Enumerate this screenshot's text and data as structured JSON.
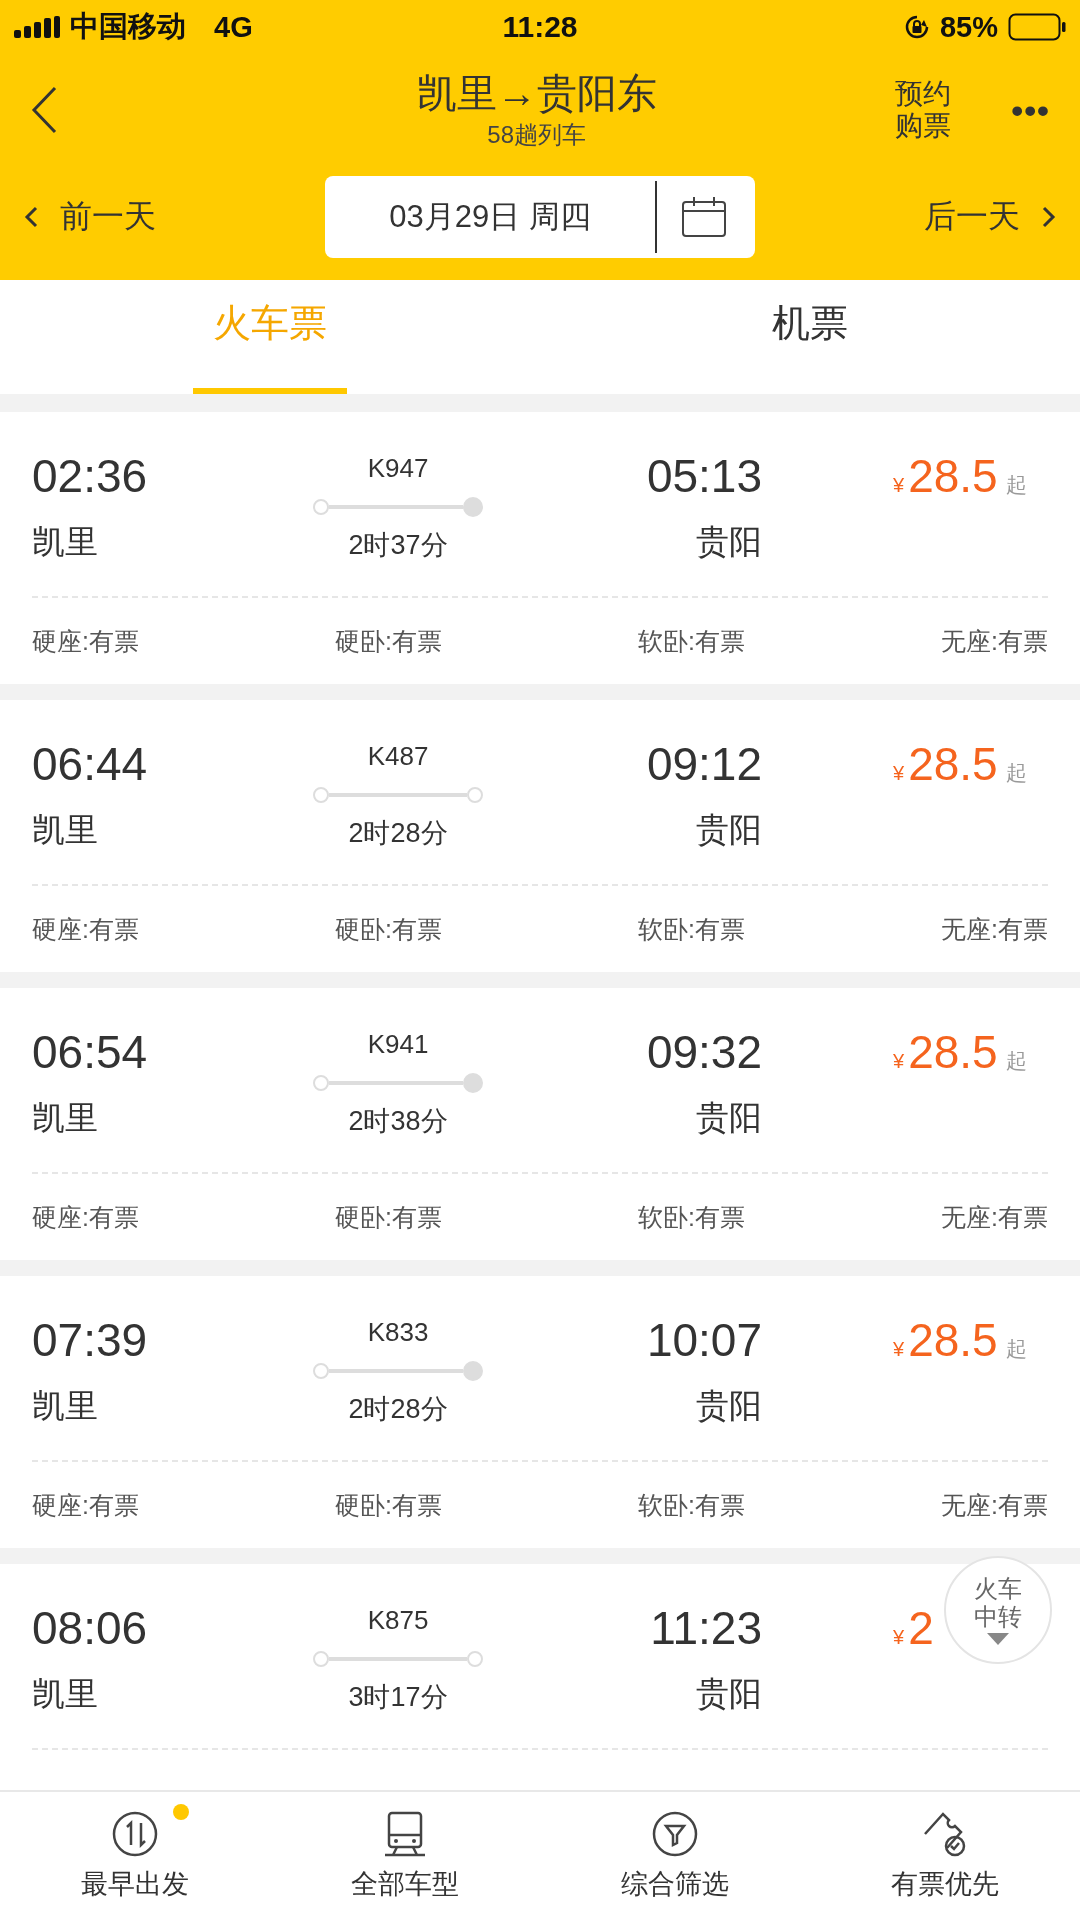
{
  "status_bar": {
    "carrier": "中国移动",
    "network": "4G",
    "time": "11:28",
    "battery": "85%"
  },
  "header": {
    "title": "凯里→贵阳东",
    "subtitle": "58趟列车",
    "action": "预约购票",
    "more": "•••"
  },
  "date_bar": {
    "prev": "前一天",
    "date": "03月29日 周四",
    "next": "后一天"
  },
  "tabs": [
    {
      "label": "火车票",
      "selected": true
    },
    {
      "label": "机票",
      "selected": false
    }
  ],
  "trains": [
    {
      "depart_time": "02:36",
      "depart_station": "凯里",
      "number": "K947",
      "duration": "2时37分",
      "arrive_time": "05:13",
      "arrive_station": "贵阳",
      "terminal": true,
      "currency": "¥",
      "price": "28.5",
      "price_suffix": "起",
      "seats": [
        "硬座:有票",
        "硬卧:有票",
        "软卧:有票",
        "无座:有票"
      ]
    },
    {
      "depart_time": "06:44",
      "depart_station": "凯里",
      "number": "K487",
      "duration": "2时28分",
      "arrive_time": "09:12",
      "arrive_station": "贵阳",
      "terminal": false,
      "currency": "¥",
      "price": "28.5",
      "price_suffix": "起",
      "seats": [
        "硬座:有票",
        "硬卧:有票",
        "软卧:有票",
        "无座:有票"
      ]
    },
    {
      "depart_time": "06:54",
      "depart_station": "凯里",
      "number": "K941",
      "duration": "2时38分",
      "arrive_time": "09:32",
      "arrive_station": "贵阳",
      "terminal": true,
      "currency": "¥",
      "price": "28.5",
      "price_suffix": "起",
      "seats": [
        "硬座:有票",
        "硬卧:有票",
        "软卧:有票",
        "无座:有票"
      ]
    },
    {
      "depart_time": "07:39",
      "depart_station": "凯里",
      "number": "K833",
      "duration": "2时28分",
      "arrive_time": "10:07",
      "arrive_station": "贵阳",
      "terminal": true,
      "currency": "¥",
      "price": "28.5",
      "price_suffix": "起",
      "seats": [
        "硬座:有票",
        "硬卧:有票",
        "软卧:有票",
        "无座:有票"
      ]
    },
    {
      "depart_time": "08:06",
      "depart_station": "凯里",
      "number": "K875",
      "duration": "3时17分",
      "arrive_time": "11:23",
      "arrive_station": "贵阳",
      "terminal": false,
      "currency": "¥",
      "price": "2"
    }
  ],
  "floating_button": {
    "label": "火车中转"
  },
  "bottom_nav": [
    {
      "kind": "sort",
      "label": "最早出发",
      "dot": true
    },
    {
      "kind": "train",
      "label": "全部车型",
      "dot": false
    },
    {
      "kind": "filter",
      "label": "综合筛选",
      "dot": false
    },
    {
      "kind": "ticket",
      "label": "有票优先",
      "dot": false
    }
  ]
}
